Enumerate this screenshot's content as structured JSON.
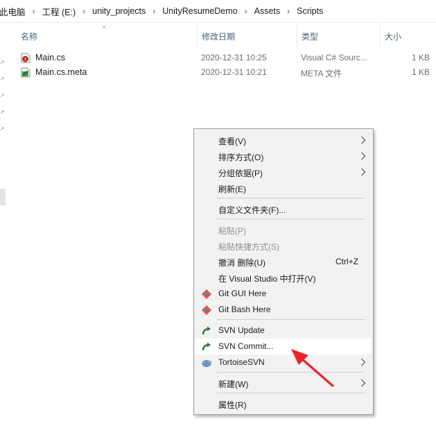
{
  "breadcrumb": {
    "items": [
      "此电脑",
      "工程 (E:)",
      "unity_projects",
      "UnityResumeDemo",
      "Assets",
      "Scripts"
    ]
  },
  "columns": {
    "name": "名称",
    "date": "修改日期",
    "type": "类型",
    "size": "大小"
  },
  "files": [
    {
      "name": "Main.cs",
      "date": "2020-12-31 10:25",
      "type": "Visual C# Sourc...",
      "size": "1 KB",
      "icon": "csharp-file-icon"
    },
    {
      "name": "Main.cs.meta",
      "date": "2020-12-31 10:21",
      "type": "META 文件",
      "size": "1 KB",
      "icon": "meta-file-icon"
    }
  ],
  "context_menu": {
    "view": "查看(V)",
    "sort_by": "排序方式(O)",
    "group_by": "分组依据(P)",
    "refresh": "刷新(E)",
    "customize_folder": "自定义文件夹(F)...",
    "paste": "粘贴(P)",
    "paste_shortcut": "粘贴快捷方式(S)",
    "undo_delete": "撤消 删除(U)",
    "undo_shortcut": "Ctrl+Z",
    "open_in_vs": "在 Visual Studio 中打开(V)",
    "git_gui": "Git GUI Here",
    "git_bash": "Git Bash Here",
    "svn_update": "SVN Update",
    "svn_commit": "SVN Commit...",
    "tortoise_svn": "TortoiseSVN",
    "new": "新建(W)",
    "properties": "属性(R)"
  },
  "colors": {
    "menu_background": "#f2f2f2",
    "menu_hover": "#ffffff",
    "annotation_arrow": "#e8242a",
    "header_text": "#4c607a",
    "disabled_text": "#8f8f8f"
  }
}
